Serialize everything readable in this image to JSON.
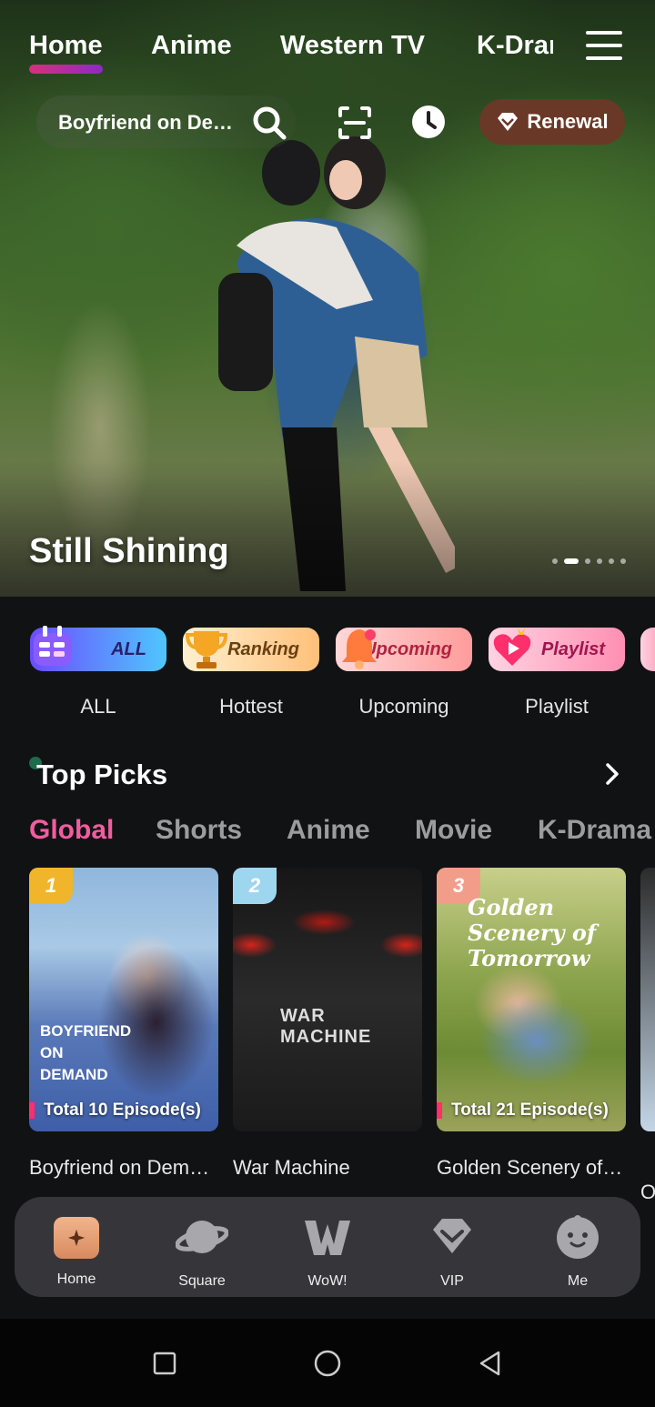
{
  "topnav": {
    "tabs": [
      "Home",
      "Anime",
      "Western TV",
      "K-Drama"
    ],
    "active": "Home"
  },
  "search": {
    "text": "Boyfriend on Demand",
    "renewal_label": "Renewal"
  },
  "hero": {
    "title": "Still Shining",
    "slide_count": 6,
    "active_slide": 2
  },
  "categories": [
    {
      "pill": "ALL",
      "label": "ALL"
    },
    {
      "pill": "Ranking",
      "label": "Hottest"
    },
    {
      "pill": "Upcoming",
      "label": "Upcoming"
    },
    {
      "pill": "Playlist",
      "label": "Playlist"
    }
  ],
  "top_picks": {
    "title": "Top Picks",
    "filters": [
      "Global",
      "Shorts",
      "Anime",
      "Movie",
      "K-Drama"
    ],
    "active_filter": "Global",
    "cards": [
      {
        "rank": "1",
        "episodes": "Total 10 Episode(s)",
        "title": "Boyfriend on Demand",
        "poster_text": "BOYFRIEND ON DEMAND"
      },
      {
        "rank": "2",
        "episodes": "",
        "title": "War Machine",
        "poster_text": "WAR MACHINE"
      },
      {
        "rank": "3",
        "episodes": "Total 21 Episode(s)",
        "title": "Golden Scenery of Tomorrow",
        "poster_text": "Golden Scenery of Tomorrow"
      }
    ],
    "peek_title": "O"
  },
  "tabbar": {
    "items": [
      "Home",
      "Square",
      "WoW!",
      "VIP",
      "Me"
    ],
    "active": "Home"
  },
  "colors": {
    "accent_pink": "#f25ca0",
    "renewal_bg": "#6a3826",
    "tabbar_bg": "#3a3a3e"
  }
}
